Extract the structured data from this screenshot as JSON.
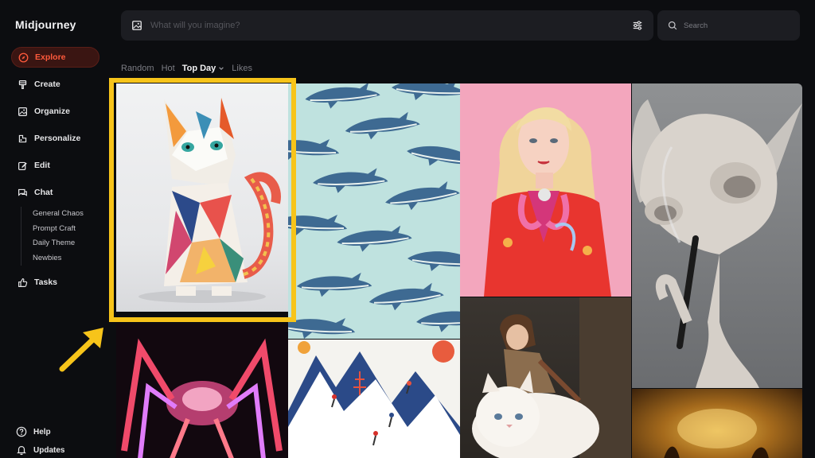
{
  "app": {
    "logo": "Midjourney"
  },
  "sidebar": {
    "items": [
      {
        "label": "Explore",
        "icon": "compass-icon",
        "active": true
      },
      {
        "label": "Create",
        "icon": "brush-icon"
      },
      {
        "label": "Organize",
        "icon": "image-icon"
      },
      {
        "label": "Personalize",
        "icon": "palette-icon"
      },
      {
        "label": "Edit",
        "icon": "edit-icon"
      },
      {
        "label": "Chat",
        "icon": "chat-icon"
      }
    ],
    "chat_rooms": [
      "General Chaos",
      "Prompt Craft",
      "Daily Theme",
      "Newbies"
    ],
    "tasks": {
      "label": "Tasks",
      "icon": "thumbs-up-icon"
    },
    "bottom": [
      {
        "label": "Help",
        "icon": "help-icon"
      },
      {
        "label": "Updates",
        "icon": "bell-icon"
      }
    ]
  },
  "prompt": {
    "placeholder": "What will you imagine?"
  },
  "search": {
    "placeholder": "Search"
  },
  "tabs": [
    "Random",
    "Hot",
    "Top Day",
    "Likes"
  ],
  "selected_tab": "Top Day",
  "colors": {
    "accent": "#ff5a3c",
    "highlight": "#f7c41a",
    "background": "#0c0d10"
  }
}
